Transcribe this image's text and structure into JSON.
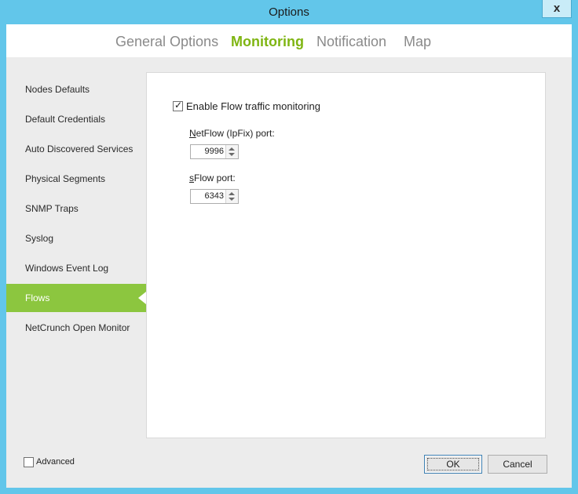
{
  "window": {
    "title": "Options",
    "close_glyph": "x"
  },
  "tabs": [
    {
      "label": "General Options",
      "active": false
    },
    {
      "label": "Monitoring",
      "active": true
    },
    {
      "label": "Notification",
      "active": false
    },
    {
      "label": "Map",
      "active": false
    }
  ],
  "sidebar": {
    "items": [
      {
        "label": "Nodes Defaults"
      },
      {
        "label": "Default Credentials"
      },
      {
        "label": "Auto Discovered Services"
      },
      {
        "label": "Physical Segments"
      },
      {
        "label": "SNMP Traps"
      },
      {
        "label": "Syslog"
      },
      {
        "label": "Windows Event Log"
      },
      {
        "label": "Flows",
        "selected": true
      },
      {
        "label": "NetCrunch Open Monitor"
      }
    ]
  },
  "flows": {
    "enable_label": "Enable Flow traffic monitoring",
    "enable_checked": true,
    "netflow_label_accel": "N",
    "netflow_label_rest": "etFlow (IpFix) port:",
    "netflow_port": "9996",
    "sflow_label_accel": "s",
    "sflow_label_rest": "Flow port:",
    "sflow_port": "6343"
  },
  "footer": {
    "advanced_label": "Advanced",
    "advanced_checked": false,
    "ok_label": "OK",
    "cancel_label": "Cancel"
  },
  "colors": {
    "accent": "#8cc63f",
    "tab_active": "#7fb512",
    "frame": "#62c6ea"
  }
}
